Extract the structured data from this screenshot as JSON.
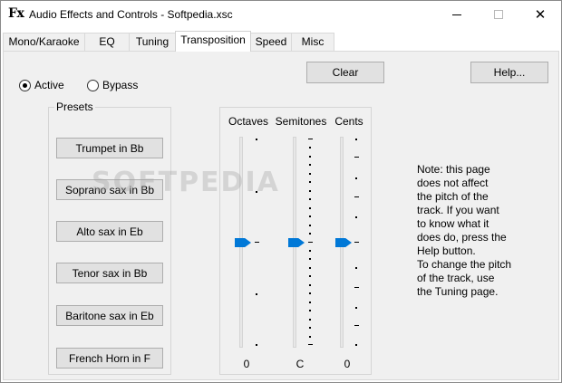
{
  "window": {
    "app_icon": "Fx",
    "title": "Audio Effects and Controls - Softpedia.xsc",
    "close_glyph": "✕"
  },
  "tabs": [
    {
      "label": "Mono/Karaoke",
      "active": false
    },
    {
      "label": "EQ",
      "active": false
    },
    {
      "label": "Tuning",
      "active": false
    },
    {
      "label": "Transposition",
      "active": true
    },
    {
      "label": "Speed",
      "active": false
    },
    {
      "label": "Misc",
      "active": false
    }
  ],
  "toolbar": {
    "clear_label": "Clear",
    "help_label": "Help..."
  },
  "mode": {
    "active_label": "Active",
    "bypass_label": "Bypass",
    "selected": "Active"
  },
  "presets": {
    "title": "Presets",
    "items": [
      "Trumpet in Bb",
      "Soprano sax in Bb",
      "Alto sax in Eb",
      "Tenor sax in Bb",
      "Baritone sax in Eb",
      "French Horn in F"
    ]
  },
  "sliders": {
    "octaves": {
      "label": "Octaves",
      "value": "0",
      "position_fraction": 0.5
    },
    "semitones": {
      "label": "Semitones",
      "value": "C",
      "position_fraction": 0.5
    },
    "cents": {
      "label": "Cents",
      "value": "0",
      "position_fraction": 0.5
    }
  },
  "note": "Note: this page\ndoes not affect\nthe pitch of the\ntrack. If you want\nto know what it\ndoes do, press the\nHelp button.\nTo change the pitch\nof the track, use\nthe Tuning page.",
  "watermark": "SOFTPEDIA",
  "colors": {
    "accent": "#0078d7",
    "button_face": "#e1e1e1",
    "panel": "#f0f0f0"
  }
}
